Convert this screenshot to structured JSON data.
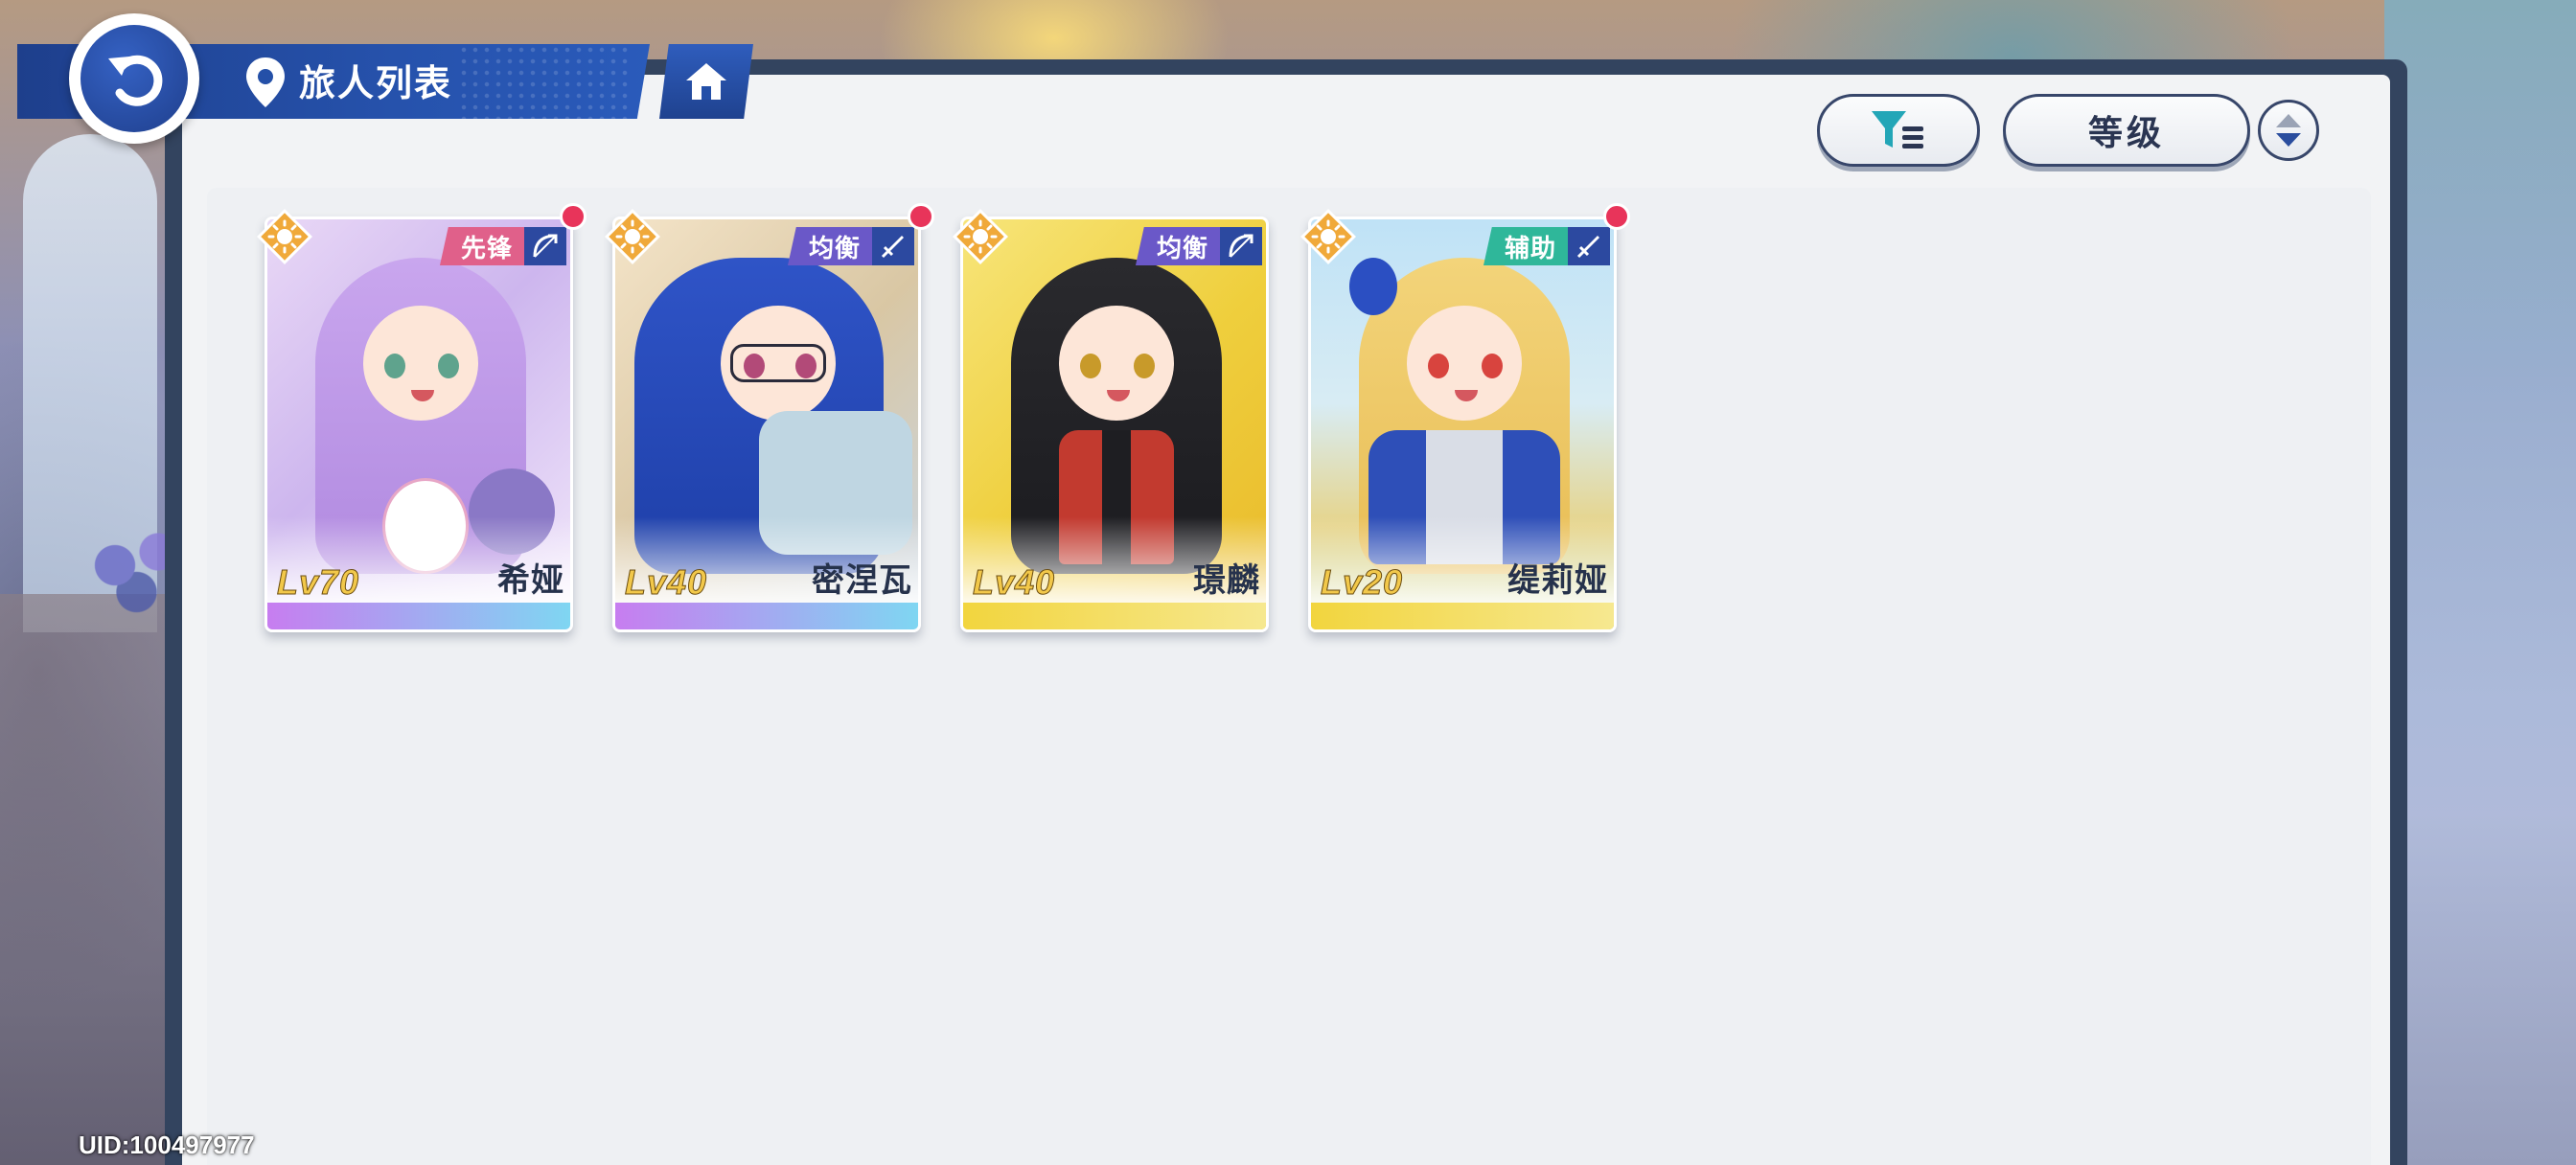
{
  "header": {
    "title": "旅人列表",
    "back_icon": "back-arrow-icon",
    "location_icon": "location-pin-icon",
    "home_icon": "home-icon"
  },
  "controls": {
    "filter_icon": "filter-icon",
    "sort_label": "等级",
    "order_icon": "sort-order-icon"
  },
  "colors": {
    "accent_blue": "#2652ac",
    "panel_bg": "#f2f3f5",
    "notify_red": "#e8345a",
    "level_gold": "#f2c84a"
  },
  "characters": [
    {
      "name": "希娅",
      "level": "Lv70",
      "role": "先锋",
      "role_color": "#e0608a",
      "weapon_icon": "bow-icon",
      "element_icon": "sun-element-icon",
      "rarity_bar": "purple-cyan",
      "has_notification": true
    },
    {
      "name": "密涅瓦",
      "level": "Lv40",
      "role": "均衡",
      "role_color": "#6a58c8",
      "weapon_icon": "sword-icon",
      "element_icon": "sun-element-icon",
      "rarity_bar": "purple-cyan",
      "has_notification": true
    },
    {
      "name": "璟麟",
      "level": "Lv40",
      "role": "均衡",
      "role_color": "#6a58c8",
      "weapon_icon": "bow-icon",
      "element_icon": "sun-element-icon",
      "rarity_bar": "gold",
      "has_notification": false
    },
    {
      "name": "缇莉娅",
      "level": "Lv20",
      "role": "辅助",
      "role_color": "#2fb79a",
      "weapon_icon": "sword-icon",
      "element_icon": "sun-element-icon",
      "rarity_bar": "gold",
      "has_notification": true
    }
  ],
  "footer": {
    "uid": "UID:100497977"
  }
}
